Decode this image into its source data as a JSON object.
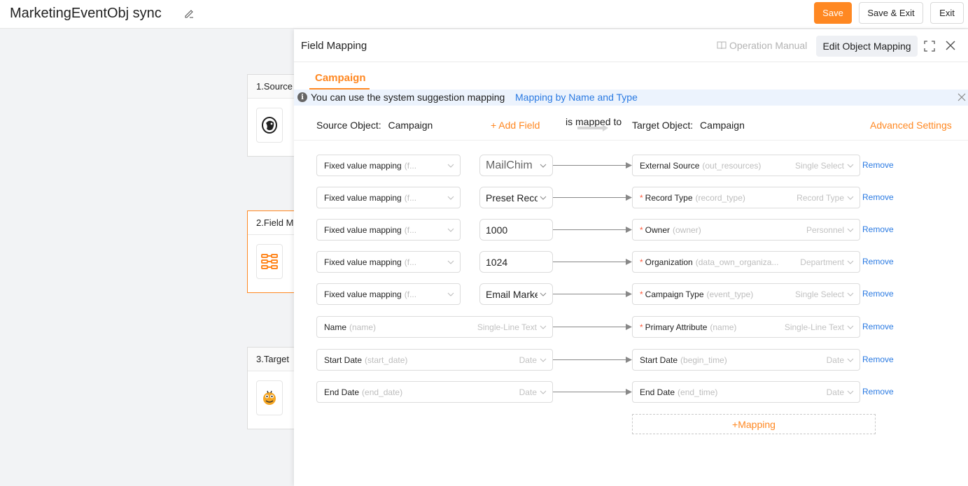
{
  "header": {
    "title": "MarketingEventObj sync",
    "save_label": "Save",
    "save_exit_label": "Save & Exit",
    "exit_label": "Exit"
  },
  "steps": [
    {
      "label": "1.Source",
      "icon": "mailchimp-icon",
      "active": false
    },
    {
      "label": "2.Field M",
      "icon": "field-mapping-icon",
      "active": true
    },
    {
      "label": "3.Target",
      "icon": "target-app-icon",
      "active": false
    }
  ],
  "panel": {
    "title": "Field Mapping",
    "operation_manual": "Operation Manual",
    "edit_object_mapping": "Edit Object Mapping",
    "tab": "Campaign",
    "tip_text": "You can use the system suggestion mapping",
    "tip_link": "Mapping by Name and Type",
    "source_object_label": "Source Object:",
    "source_object_value": "Campaign",
    "add_field": "+ Add Field",
    "is_mapped_to": "is mapped to",
    "target_object_label": "Target Object:",
    "target_object_value": "Campaign",
    "advanced_settings": "Advanced Settings",
    "add_mapping": "+Mapping"
  },
  "rows": [
    {
      "src_label": "Fixed value mapping",
      "src_hint": "(f...",
      "value": "MailChim",
      "value_big": true,
      "value_dropdown": true,
      "required": false,
      "tgt_label": "External Source",
      "tgt_hint": "(out_resources)",
      "tgt_type": "Single Select",
      "remove": "Remove"
    },
    {
      "src_label": "Fixed value mapping",
      "src_hint": "(f...",
      "value": "Preset Reco",
      "value_big": false,
      "value_dropdown": true,
      "required": true,
      "tgt_label": "Record Type",
      "tgt_hint": "(record_type)",
      "tgt_type": "Record Type",
      "remove": "Remove"
    },
    {
      "src_label": "Fixed value mapping",
      "src_hint": "(f...",
      "value": "1000",
      "value_big": false,
      "value_dropdown": false,
      "required": true,
      "tgt_label": "Owner",
      "tgt_hint": "(owner)",
      "tgt_type": "Personnel",
      "remove": "Remove"
    },
    {
      "src_label": "Fixed value mapping",
      "src_hint": "(f...",
      "value": "1024",
      "value_big": false,
      "value_dropdown": false,
      "required": true,
      "tgt_label": "Organization",
      "tgt_hint": "(data_own_organiza...",
      "tgt_type": "Department",
      "remove": "Remove"
    },
    {
      "src_label": "Fixed value mapping",
      "src_hint": "(f...",
      "value": "Email Marke",
      "value_big": false,
      "value_dropdown": true,
      "required": true,
      "tgt_label": "Campaign Type",
      "tgt_hint": "(event_type)",
      "tgt_type": "Single Select",
      "remove": "Remove"
    },
    {
      "src_label": "Name",
      "src_hint": "(name)",
      "src_type": "Single-Line Text",
      "required": true,
      "tgt_label": "Primary Attribute",
      "tgt_hint": "(name)",
      "tgt_type": "Single-Line Text",
      "remove": "Remove"
    },
    {
      "src_label": "Start Date",
      "src_hint": "(start_date)",
      "src_type": "Date",
      "required": false,
      "tgt_label": "Start Date",
      "tgt_hint": "(begin_time)",
      "tgt_type": "Date",
      "remove": "Remove"
    },
    {
      "src_label": "End Date",
      "src_hint": "(end_date)",
      "src_type": "Date",
      "required": false,
      "tgt_label": "End Date",
      "tgt_hint": "(end_time)",
      "tgt_type": "Date",
      "remove": "Remove"
    }
  ],
  "colors": {
    "accent": "#ff8822",
    "link": "#2a7ae2",
    "required": "#ff5a3d"
  }
}
